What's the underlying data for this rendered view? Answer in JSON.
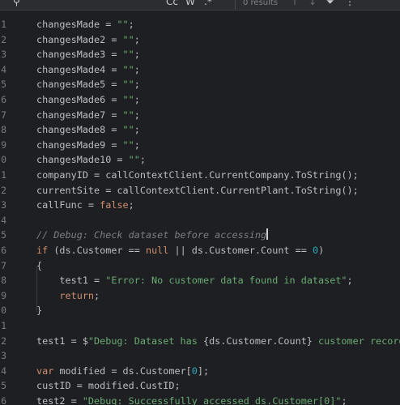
{
  "search": {
    "options": [
      "Cc",
      "W",
      ".*"
    ],
    "results": "0 results"
  },
  "lines": [
    {
      "n": "1",
      "tokens": [
        {
          "t": "changesMade = ",
          "c": ""
        },
        {
          "t": "\"\"",
          "c": "str"
        },
        {
          "t": ";",
          "c": ""
        }
      ]
    },
    {
      "n": "2",
      "tokens": [
        {
          "t": "changesMade2 = ",
          "c": ""
        },
        {
          "t": "\"\"",
          "c": "str"
        },
        {
          "t": ";",
          "c": ""
        }
      ]
    },
    {
      "n": "3",
      "tokens": [
        {
          "t": "changesMade3 = ",
          "c": ""
        },
        {
          "t": "\"\"",
          "c": "str"
        },
        {
          "t": ";",
          "c": ""
        }
      ]
    },
    {
      "n": "4",
      "tokens": [
        {
          "t": "changesMade4 = ",
          "c": ""
        },
        {
          "t": "\"\"",
          "c": "str"
        },
        {
          "t": ";",
          "c": ""
        }
      ]
    },
    {
      "n": "5",
      "tokens": [
        {
          "t": "changesMade5 = ",
          "c": ""
        },
        {
          "t": "\"\"",
          "c": "str"
        },
        {
          "t": ";",
          "c": ""
        }
      ]
    },
    {
      "n": "6",
      "tokens": [
        {
          "t": "changesMade6 = ",
          "c": ""
        },
        {
          "t": "\"\"",
          "c": "str"
        },
        {
          "t": ";",
          "c": ""
        }
      ]
    },
    {
      "n": "7",
      "tokens": [
        {
          "t": "changesMade7 = ",
          "c": ""
        },
        {
          "t": "\"\"",
          "c": "str"
        },
        {
          "t": ";",
          "c": ""
        }
      ]
    },
    {
      "n": "8",
      "tokens": [
        {
          "t": "changesMade8 = ",
          "c": ""
        },
        {
          "t": "\"\"",
          "c": "str"
        },
        {
          "t": ";",
          "c": ""
        }
      ]
    },
    {
      "n": "9",
      "tokens": [
        {
          "t": "changesMade9 = ",
          "c": ""
        },
        {
          "t": "\"\"",
          "c": "str"
        },
        {
          "t": ";",
          "c": ""
        }
      ]
    },
    {
      "n": "0",
      "tokens": [
        {
          "t": "changesMade10 = ",
          "c": ""
        },
        {
          "t": "\"\"",
          "c": "str"
        },
        {
          "t": ";",
          "c": ""
        }
      ]
    },
    {
      "n": "1",
      "tokens": [
        {
          "t": "companyID = callContextClient.CurrentCompany.ToString();",
          "c": ""
        }
      ]
    },
    {
      "n": "2",
      "tokens": [
        {
          "t": "currentSite = callContextClient.CurrentPlant.ToString();",
          "c": ""
        }
      ]
    },
    {
      "n": "3",
      "tokens": [
        {
          "t": "callFunc = ",
          "c": ""
        },
        {
          "t": "false",
          "c": "kw"
        },
        {
          "t": ";",
          "c": ""
        }
      ]
    },
    {
      "n": "4",
      "tokens": []
    },
    {
      "n": "5",
      "tokens": [
        {
          "t": "// Debug: Check dataset before accessing",
          "c": "cmt"
        }
      ],
      "caret": true
    },
    {
      "n": "6",
      "tokens": [
        {
          "t": "if",
          "c": "kw"
        },
        {
          "t": " (ds.Customer == ",
          "c": ""
        },
        {
          "t": "null",
          "c": "kw"
        },
        {
          "t": " || ds.Customer.Count == ",
          "c": ""
        },
        {
          "t": "0",
          "c": "num"
        },
        {
          "t": ")",
          "c": ""
        }
      ]
    },
    {
      "n": "7",
      "tokens": [
        {
          "t": "{",
          "c": ""
        }
      ]
    },
    {
      "n": "8",
      "tokens": [
        {
          "t": "    test1 = ",
          "c": ""
        },
        {
          "t": "\"Error: No customer data found in dataset\"",
          "c": "str"
        },
        {
          "t": ";",
          "c": ""
        }
      ]
    },
    {
      "n": "9",
      "tokens": [
        {
          "t": "    ",
          "c": ""
        },
        {
          "t": "return",
          "c": "kw"
        },
        {
          "t": ";",
          "c": ""
        }
      ]
    },
    {
      "n": "0",
      "tokens": [
        {
          "t": "}",
          "c": ""
        }
      ]
    },
    {
      "n": "1",
      "tokens": []
    },
    {
      "n": "2",
      "tokens": [
        {
          "t": "test1 = $",
          "c": ""
        },
        {
          "t": "\"Debug: Dataset has ",
          "c": "str"
        },
        {
          "t": "{ds.Customer.Count}",
          "c": "fld"
        },
        {
          "t": " customer records\"",
          "c": "str"
        },
        {
          "t": ";",
          "c": ""
        }
      ]
    },
    {
      "n": "3",
      "tokens": []
    },
    {
      "n": "4",
      "tokens": [
        {
          "t": "var",
          "c": "kw"
        },
        {
          "t": " modified = ds.Customer[",
          "c": ""
        },
        {
          "t": "0",
          "c": "num"
        },
        {
          "t": "];",
          "c": ""
        }
      ]
    },
    {
      "n": "5",
      "tokens": [
        {
          "t": "custID = modified.CustID;",
          "c": ""
        }
      ]
    },
    {
      "n": "6",
      "tokens": [
        {
          "t": "test2 = ",
          "c": ""
        },
        {
          "t": "\"Debug: Successfully accessed ds.Customer[0]\"",
          "c": "str"
        },
        {
          "t": ";",
          "c": ""
        }
      ]
    }
  ]
}
